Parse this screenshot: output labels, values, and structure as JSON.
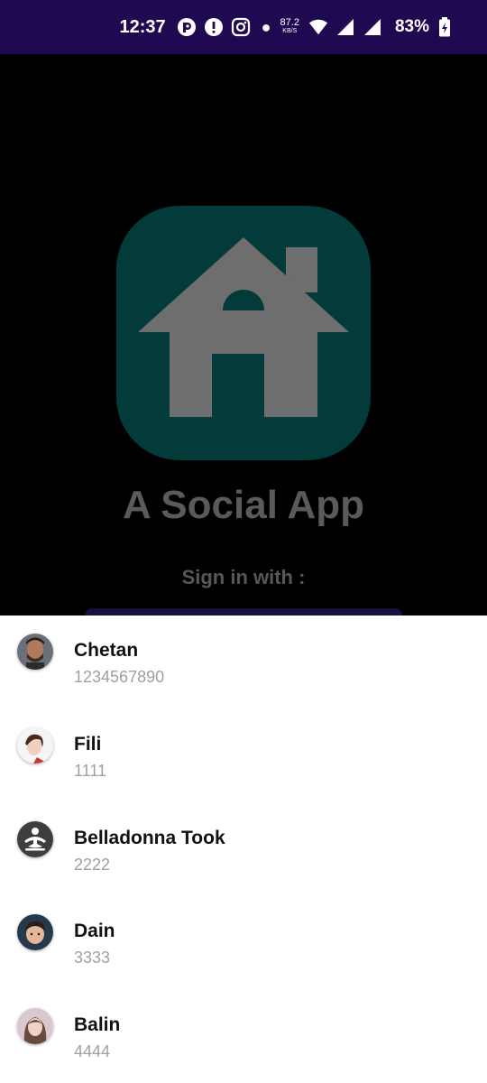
{
  "status_bar": {
    "time": "12:37",
    "speed_value": "87.2",
    "speed_unit": "KB/S",
    "battery": "83%",
    "icons": [
      "notification-icon",
      "alert-icon",
      "instagram-icon",
      "wifi-icon",
      "signal-icon",
      "signal-icon",
      "battery-icon"
    ]
  },
  "app": {
    "title": "A Social App",
    "signin_label": "Sign in with :",
    "icon": "house-icon",
    "icon_bg": "#023b3a",
    "icon_fg": "#6e6e6e"
  },
  "accounts": [
    {
      "name": "Chetan",
      "phone": "1234567890",
      "avatar": "avatar-man-photo"
    },
    {
      "name": "Fili",
      "phone": "1111",
      "avatar": "avatar-woman-photo"
    },
    {
      "name": "Belladonna Took",
      "phone": "2222",
      "avatar": "meditation-icon"
    },
    {
      "name": "Dain",
      "phone": "3333",
      "avatar": "avatar-child-photo"
    },
    {
      "name": "Balin",
      "phone": "4444",
      "avatar": "avatar-girl-photo"
    }
  ]
}
